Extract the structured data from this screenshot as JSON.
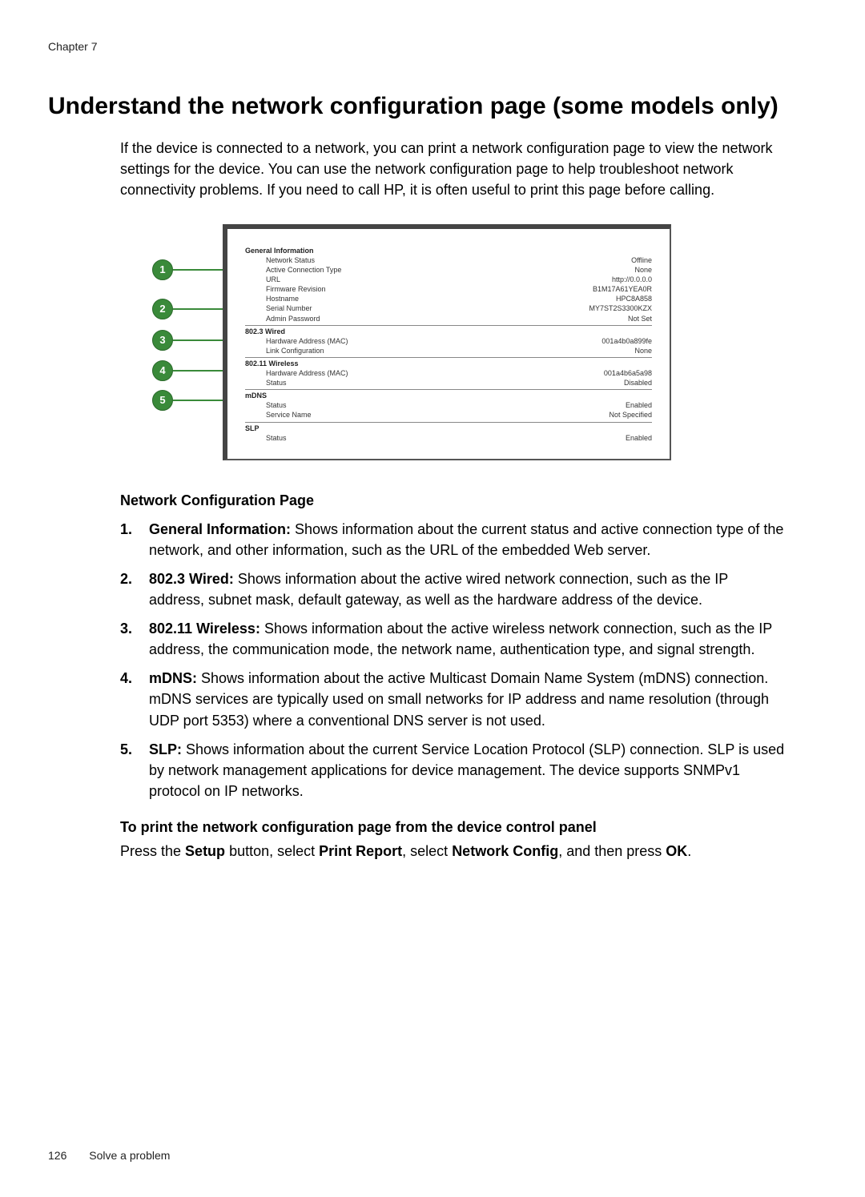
{
  "header": {
    "chapter": "Chapter 7"
  },
  "title": "Understand the network configuration page (some models only)",
  "intro": "If the device is connected to a network, you can print a network configuration page to view the network settings for the device. You can use the network configuration page to help troubleshoot network connectivity problems. If you need to call HP, it is often useful to print this page before calling.",
  "callouts": [
    "1",
    "2",
    "3",
    "4",
    "5"
  ],
  "config": {
    "general": {
      "title": "General Information",
      "rows": [
        {
          "label": "Network Status",
          "value": "Offline"
        },
        {
          "label": "Active Connection Type",
          "value": "None"
        },
        {
          "label": "URL",
          "value": "http://0.0.0.0"
        },
        {
          "label": "Firmware Revision",
          "value": "B1M17A61YEA0R"
        },
        {
          "label": "Hostname",
          "value": "HPC8A858"
        },
        {
          "label": "Serial Number",
          "value": "MY7ST2S3300KZX"
        },
        {
          "label": "Admin Password",
          "value": "Not Set"
        }
      ]
    },
    "wired": {
      "title": "802.3 Wired",
      "rows": [
        {
          "label": "Hardware Address (MAC)",
          "value": "001a4b0a899fe"
        },
        {
          "label": "Link Configuration",
          "value": "None"
        }
      ]
    },
    "wireless": {
      "title": "802.11 Wireless",
      "rows": [
        {
          "label": "Hardware Address (MAC)",
          "value": "001a4b6a5a98"
        },
        {
          "label": "Status",
          "value": "Disabled"
        }
      ]
    },
    "mdns": {
      "title": "mDNS",
      "rows": [
        {
          "label": "Status",
          "value": "Enabled"
        },
        {
          "label": "Service Name",
          "value": "Not Specified"
        }
      ]
    },
    "slp": {
      "title": "SLP",
      "rows": [
        {
          "label": "Status",
          "value": "Enabled"
        }
      ]
    }
  },
  "section_heading": "Network Configuration Page",
  "items": [
    {
      "num": "1.",
      "term": "General Information:",
      "text": " Shows information about the current status and active connection type of the network, and other information, such as the URL of the embedded Web server."
    },
    {
      "num": "2.",
      "term": "802.3 Wired:",
      "text": " Shows information about the active wired network connection, such as the IP address, subnet mask, default gateway, as well as the hardware address of the device."
    },
    {
      "num": "3.",
      "term": "802.11 Wireless:",
      "text": " Shows information about the active wireless network connection, such as the IP address, the communication mode, the network name, authentication type, and signal strength."
    },
    {
      "num": "4.",
      "term": "mDNS:",
      "text": " Shows information about the active Multicast Domain Name System (mDNS) connection. mDNS services are typically used on small networks for IP address and name resolution (through UDP port 5353) where a conventional DNS server is not used."
    },
    {
      "num": "5.",
      "term": "SLP:",
      "text": " Shows information about the current Service Location Protocol (SLP) connection. SLP is used by network management applications for device management. The device supports SNMPv1 protocol on IP networks."
    }
  ],
  "print": {
    "heading": "To print the network configuration page from the device control panel",
    "pre": "Press the ",
    "b1": "Setup",
    "mid1": " button, select ",
    "b2": "Print Report",
    "mid2": ", select ",
    "b3": "Network Config",
    "mid3": ", and then press ",
    "b4": "OK",
    "end": "."
  },
  "footer": {
    "page": "126",
    "title": "Solve a problem"
  }
}
